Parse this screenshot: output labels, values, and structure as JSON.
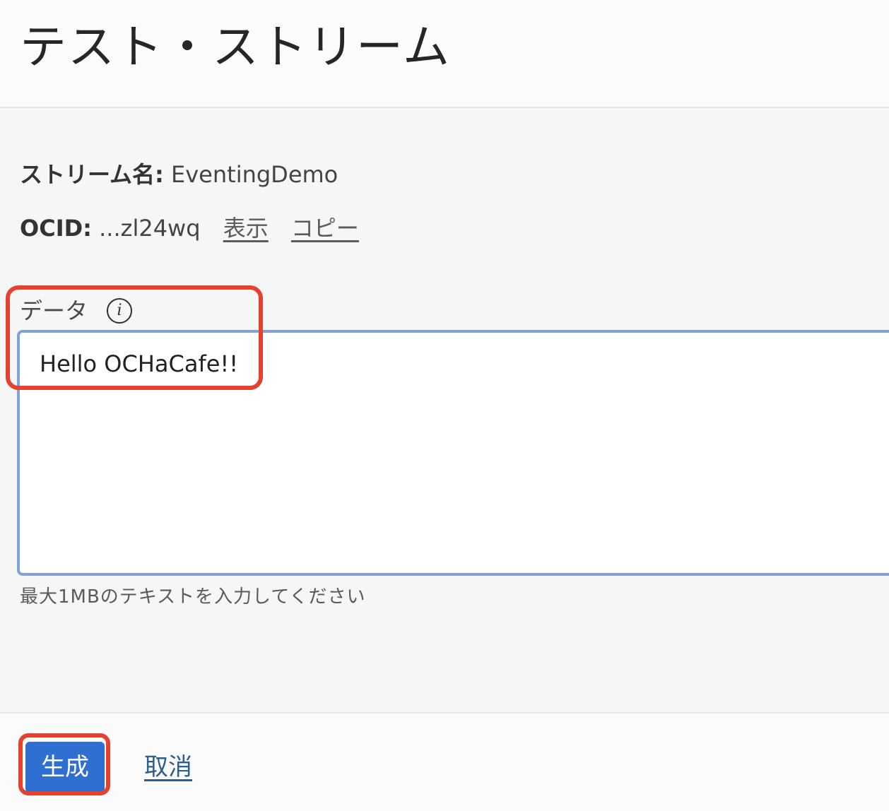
{
  "header": {
    "title": "テスト・ストリーム"
  },
  "details": {
    "stream_name_label": "ストリーム名:",
    "stream_name_value": "EventingDemo",
    "ocid_label": "OCID:",
    "ocid_value": "...zl24wq",
    "show_link": "表示",
    "copy_link": "コピー"
  },
  "form": {
    "data_label": "データ",
    "info_icon": "info-icon",
    "info_glyph": "i",
    "data_value": "Hello OCHaCafe!!",
    "hint": "最大1MBのテキストを入力してください"
  },
  "footer": {
    "create_button": "生成",
    "cancel_link": "取消"
  },
  "colors": {
    "primary": "#2e6fcf",
    "textarea_border": "#7fa3d9",
    "annotation": "#e5412f",
    "link": "#2c5f8a"
  }
}
